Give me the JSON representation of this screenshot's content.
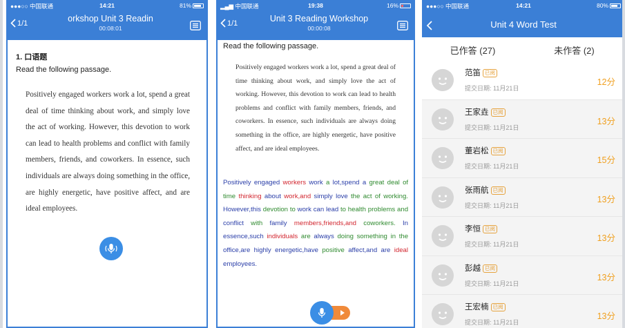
{
  "screen1": {
    "status": {
      "carrier": "●●●○○ 中国联通",
      "time": "14:21",
      "battery": "81%"
    },
    "header": {
      "back_label": "1/1",
      "title": "orkshop   Unit 3 Readin",
      "timer": "00:08:01"
    },
    "question_title": "1. 口语题",
    "instruction": "Read the following passage.",
    "passage": "Positively engaged workers work a lot, spend a great deal of time thinking about work, and simply love the act of working. However, this devotion to work can lead to health problems and conflict with family members, friends, and coworkers. In essence, such individuals are always doing something in the office, are highly energetic, have positive affect, and are ideal employees."
  },
  "screen2": {
    "status": {
      "carrier": "中国联通",
      "time": "19:38",
      "battery": "16%"
    },
    "header": {
      "back_label": "1/1",
      "title": "Unit 3 Reading Workshop",
      "timer": "00:00:08"
    },
    "instruction": "Read the following passage.",
    "passage": "Positively engaged workers work a lot, spend a great deal of time thinking about work, and simply love the act of working. However, this devotion to work can lead to health problems and conflict with family members, friends, and coworkers. In essence, such individuals are always doing something in the office, are highly energetic, have positive affect, and are ideal employees.",
    "scored_words": [
      {
        "t": "Positively",
        "c": "b"
      },
      {
        "t": "engaged",
        "c": "b"
      },
      {
        "t": "workers",
        "c": "r"
      },
      {
        "t": "work",
        "c": "b"
      },
      {
        "t": "a",
        "c": "g"
      },
      {
        "t": "lot,spend",
        "c": "b"
      },
      {
        "t": "a",
        "c": "b"
      },
      {
        "t": "great",
        "c": "g"
      },
      {
        "t": "deal",
        "c": "g"
      },
      {
        "t": "of",
        "c": "g"
      },
      {
        "t": "time",
        "c": "g"
      },
      {
        "t": "thinking",
        "c": "r"
      },
      {
        "t": "about",
        "c": "b"
      },
      {
        "t": "work,and",
        "c": "r"
      },
      {
        "t": "simply",
        "c": "b"
      },
      {
        "t": "love",
        "c": "b"
      },
      {
        "t": "the",
        "c": "g"
      },
      {
        "t": "act",
        "c": "g"
      },
      {
        "t": "of",
        "c": "g"
      },
      {
        "t": "working.",
        "c": "g"
      },
      {
        "t": "However,this",
        "c": "b"
      },
      {
        "t": "devotion",
        "c": "g"
      },
      {
        "t": "to",
        "c": "g"
      },
      {
        "t": "work",
        "c": "b"
      },
      {
        "t": "can",
        "c": "b"
      },
      {
        "t": "lead",
        "c": "b"
      },
      {
        "t": "to",
        "c": "g"
      },
      {
        "t": "health",
        "c": "g"
      },
      {
        "t": "problems",
        "c": "g"
      },
      {
        "t": "and",
        "c": "g"
      },
      {
        "t": "conflict",
        "c": "b"
      },
      {
        "t": "with",
        "c": "g"
      },
      {
        "t": "family",
        "c": "b"
      },
      {
        "t": "members,friends,and",
        "c": "r"
      },
      {
        "t": "coworkers.",
        "c": "g"
      },
      {
        "t": "In",
        "c": "b"
      },
      {
        "t": "essence,such",
        "c": "b"
      },
      {
        "t": "individuals",
        "c": "r"
      },
      {
        "t": "are",
        "c": "g"
      },
      {
        "t": "always",
        "c": "b"
      },
      {
        "t": "doing",
        "c": "g"
      },
      {
        "t": "something",
        "c": "g"
      },
      {
        "t": "in",
        "c": "g"
      },
      {
        "t": "the",
        "c": "g"
      },
      {
        "t": "office,are",
        "c": "b"
      },
      {
        "t": "highly",
        "c": "b"
      },
      {
        "t": "energetic,have",
        "c": "b"
      },
      {
        "t": "positive",
        "c": "g"
      },
      {
        "t": "affect,and",
        "c": "b"
      },
      {
        "t": "are",
        "c": "b"
      },
      {
        "t": "ideal",
        "c": "r"
      },
      {
        "t": "employees.",
        "c": "b"
      }
    ]
  },
  "screen3": {
    "status": {
      "carrier": "●●●○○ 中国联通",
      "time": "14:21",
      "battery": "80%"
    },
    "header": {
      "title": "Unit 4 Word Test"
    },
    "tabs": [
      {
        "label": "已作答 (27)"
      },
      {
        "label": "未作答 (2)"
      }
    ],
    "students": [
      {
        "name": "范笛",
        "tag": "已阅",
        "date": "提交日期: 11月21日",
        "score": "12分"
      },
      {
        "name": "王家垚",
        "tag": "已阅",
        "date": "提交日期: 11月21日",
        "score": "13分"
      },
      {
        "name": "董岩松",
        "tag": "已阅",
        "date": "提交日期: 11月21日",
        "score": "15分"
      },
      {
        "name": "张雨航",
        "tag": "已阅",
        "date": "提交日期: 11月21日",
        "score": "13分"
      },
      {
        "name": "李恒",
        "tag": "已阅",
        "date": "提交日期: 11月21日",
        "score": "13分"
      },
      {
        "name": "彭越",
        "tag": "已阅",
        "date": "提交日期: 11月21日",
        "score": "13分"
      },
      {
        "name": "王宏楠",
        "tag": "已阅",
        "date": "提交日期: 11月21日",
        "score": "13分"
      }
    ]
  },
  "colors": {
    "primary": "#3b7fd6",
    "score": "#f0a020",
    "tag": "#e6a23c",
    "green": "#2f8a2f",
    "red": "#d2262f",
    "blue": "#2a3ea8",
    "record": "#f08a3a"
  }
}
